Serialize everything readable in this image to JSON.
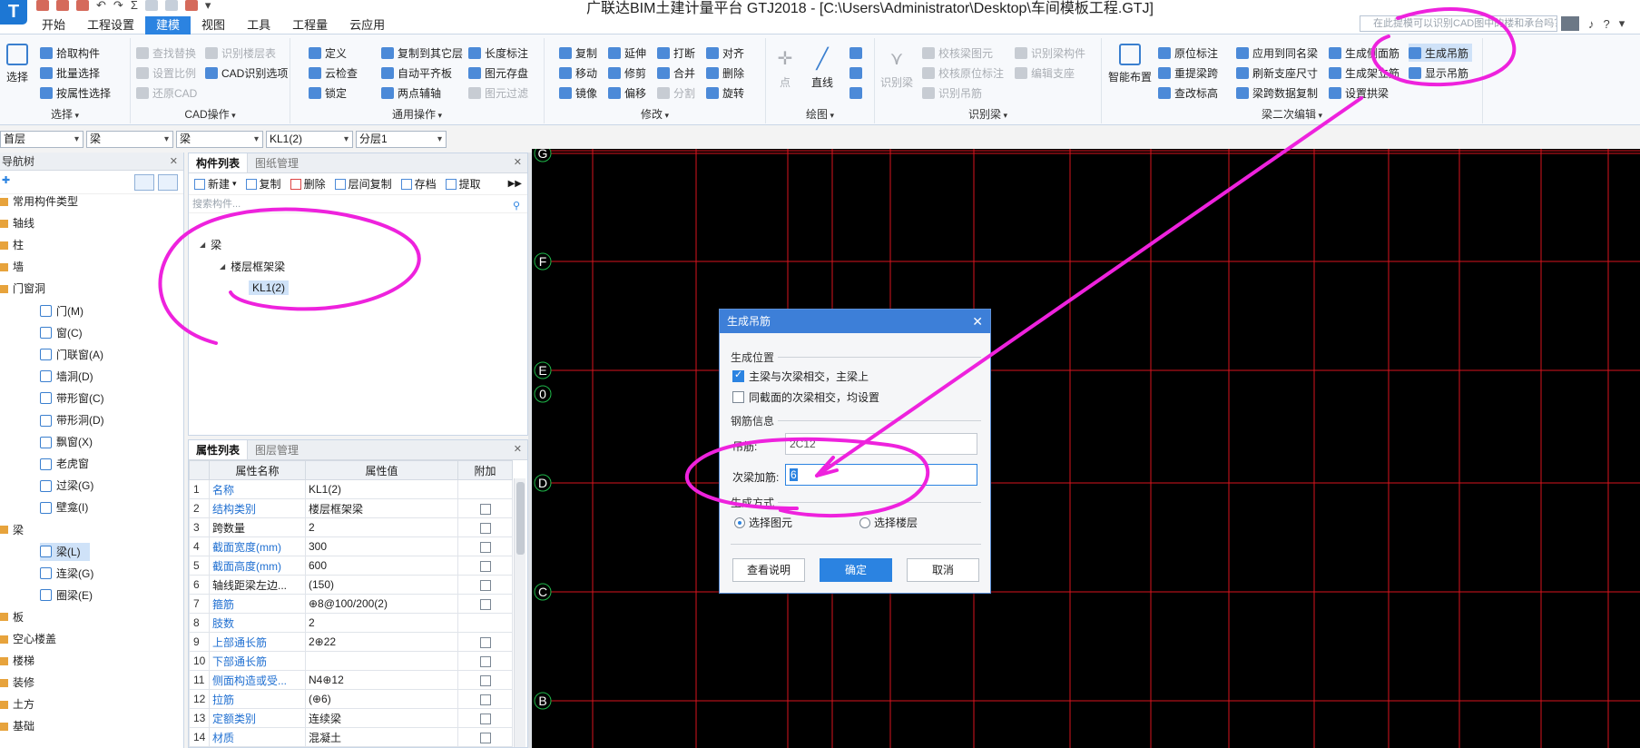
{
  "window": {
    "app_logo": "T",
    "title": "广联达BIM土建计量平台 GTJ2018 - [C:\\Users\\Administrator\\Desktop\\车间模板工程.GTJ]",
    "search_placeholder": "在此提模可以识别CAD图中的楼和承台吗？"
  },
  "menu": {
    "items": [
      "开始",
      "工程设置",
      "建模",
      "视图",
      "工具",
      "工程量",
      "云应用"
    ],
    "active": "建模"
  },
  "ribbon": {
    "select_group": {
      "label": "选择",
      "big": "选择",
      "items": [
        "拾取构件",
        "批量选择",
        "按属性选择"
      ]
    },
    "cad_group": {
      "label": "CAD操作",
      "items": [
        "查找替换",
        "识别楼层表",
        "设置比例",
        "CAD识别选项",
        "还原CAD"
      ]
    },
    "general_group": {
      "label": "通用操作",
      "items": [
        "定义",
        "复制到其它层",
        "长度标注",
        "云检查",
        "自动平齐板",
        "图元存盘",
        "锁定",
        "两点辅轴",
        "图元过滤"
      ]
    },
    "modify_group": {
      "label": "修改",
      "items": [
        "复制",
        "延伸",
        "打断",
        "对齐",
        "移动",
        "修剪",
        "合并",
        "删除",
        "镜像",
        "偏移",
        "分割",
        "旋转"
      ]
    },
    "draw_group": {
      "label": "绘图",
      "items": [
        "点",
        "直线"
      ]
    },
    "identify_group": {
      "label": "识别梁",
      "items": [
        "识别梁",
        "校核梁图元",
        "识别梁构件",
        "校核原位标注",
        "编辑支座",
        "识别吊筋"
      ]
    },
    "secondary_group": {
      "label": "梁二次编辑",
      "items": [
        "智能布置",
        "原位标注",
        "应用到同名梁",
        "生成侧面筋",
        "生成吊筋",
        "重提梁跨",
        "刷新支座尺寸",
        "生成架立筋",
        "显示吊筋",
        "查改标高",
        "梁跨数据复制",
        "设置拱梁"
      ]
    }
  },
  "combos": [
    "首层",
    "梁",
    "梁",
    "KL1(2)",
    "分层1"
  ],
  "nav": {
    "title": "导航树",
    "items": [
      {
        "label": "常用构件类型",
        "level": 0
      },
      {
        "label": "轴线",
        "level": 0
      },
      {
        "label": "柱",
        "level": 0
      },
      {
        "label": "墙",
        "level": 0
      },
      {
        "label": "门窗洞",
        "level": 0
      },
      {
        "label": "门(M)",
        "level": 1
      },
      {
        "label": "窗(C)",
        "level": 1
      },
      {
        "label": "门联窗(A)",
        "level": 1
      },
      {
        "label": "墙洞(D)",
        "level": 1
      },
      {
        "label": "带形窗(C)",
        "level": 1
      },
      {
        "label": "带形洞(D)",
        "level": 1
      },
      {
        "label": "飘窗(X)",
        "level": 1
      },
      {
        "label": "老虎窗",
        "level": 1
      },
      {
        "label": "过梁(G)",
        "level": 1
      },
      {
        "label": "壁龛(I)",
        "level": 1
      },
      {
        "label": "梁",
        "level": 0
      },
      {
        "label": "梁(L)",
        "level": 1,
        "selected": true
      },
      {
        "label": "连梁(G)",
        "level": 1
      },
      {
        "label": "圈梁(E)",
        "level": 1
      },
      {
        "label": "板",
        "level": 0
      },
      {
        "label": "空心楼盖",
        "level": 0
      },
      {
        "label": "楼梯",
        "level": 0
      },
      {
        "label": "装修",
        "level": 0
      },
      {
        "label": "土方",
        "level": 0
      },
      {
        "label": "基础",
        "level": 0
      }
    ]
  },
  "component_list": {
    "tabs": [
      "构件列表",
      "图纸管理"
    ],
    "toolbar": [
      "新建",
      "复制",
      "删除",
      "层间复制",
      "存档",
      "提取"
    ],
    "search_placeholder": "搜索构件...",
    "tree": [
      {
        "label": "梁",
        "level": 0
      },
      {
        "label": "楼层框架梁",
        "level": 1
      },
      {
        "label": "KL1(2)",
        "level": 2,
        "selected": true
      }
    ]
  },
  "property_list": {
    "tabs": [
      "属性列表",
      "图层管理"
    ],
    "headers": [
      "属性名称",
      "属性值",
      "附加"
    ],
    "rows": [
      {
        "n": "1",
        "name": "名称",
        "value": "KL1(2)",
        "blue": true,
        "check": false
      },
      {
        "n": "2",
        "name": "结构类别",
        "value": "楼层框架梁",
        "blue": true,
        "check": true
      },
      {
        "n": "3",
        "name": "跨数量",
        "value": "2",
        "blue": false,
        "check": true
      },
      {
        "n": "4",
        "name": "截面宽度(mm)",
        "value": "300",
        "blue": true,
        "check": true
      },
      {
        "n": "5",
        "name": "截面高度(mm)",
        "value": "600",
        "blue": true,
        "check": true
      },
      {
        "n": "6",
        "name": "轴线距梁左边...",
        "value": "(150)",
        "blue": false,
        "check": true
      },
      {
        "n": "7",
        "name": "箍筋",
        "value": "⊕8@100/200(2)",
        "blue": true,
        "check": true
      },
      {
        "n": "8",
        "name": "肢数",
        "value": "2",
        "blue": true,
        "check": false
      },
      {
        "n": "9",
        "name": "上部通长筋",
        "value": "2⊕22",
        "blue": true,
        "check": true
      },
      {
        "n": "10",
        "name": "下部通长筋",
        "value": "",
        "blue": true,
        "check": true
      },
      {
        "n": "11",
        "name": "侧面构造或受...",
        "value": "N4⊕12",
        "blue": true,
        "check": true
      },
      {
        "n": "12",
        "name": "拉筋",
        "value": "(⊕6)",
        "blue": true,
        "check": true
      },
      {
        "n": "13",
        "name": "定额类别",
        "value": "连续梁",
        "blue": true,
        "check": true
      },
      {
        "n": "14",
        "name": "材质",
        "value": "混凝土",
        "blue": true,
        "check": true
      }
    ]
  },
  "canvas": {
    "axis_labels": [
      "G",
      "F",
      "E",
      "0",
      "D",
      "C",
      "B"
    ]
  },
  "dialog": {
    "title": "生成吊筋",
    "section_position": "生成位置",
    "check1": "主梁与次梁相交，主梁上",
    "check2": "同截面的次梁相交，均设置",
    "section_rebar": "钢筋信息",
    "hanger_label": "吊筋:",
    "hanger_value": "2C12",
    "stirrup_label": "次梁加筋:",
    "stirrup_value": "6",
    "section_mode": "生成方式",
    "radio1": "选择图元",
    "radio2": "选择楼层",
    "btn_help": "查看说明",
    "btn_ok": "确定",
    "btn_cancel": "取消"
  },
  "colors": {
    "accent": "#2b83e1",
    "grid": "#d8141e",
    "annotation": "#ee22dd"
  }
}
